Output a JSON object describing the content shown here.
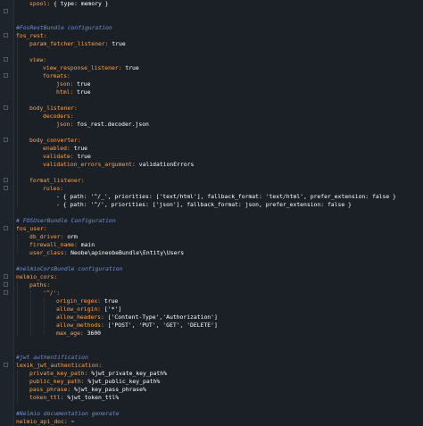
{
  "editor": {
    "lines": [
      {
        "indent": 1,
        "key": "spool:",
        "value": "{ type: memory }"
      },
      {
        "indent": 0,
        "key": "",
        "value": ""
      },
      {
        "indent": 0,
        "key": "",
        "value": ""
      },
      {
        "indent": 0,
        "comment": "#FosRestBundle configuration"
      },
      {
        "indent": 0,
        "key": "fos_rest:",
        "value": ""
      },
      {
        "indent": 1,
        "key": "param_fetcher_listener:",
        "value": "true"
      },
      {
        "indent": 0,
        "key": "",
        "value": ""
      },
      {
        "indent": 1,
        "key": "view:",
        "value": ""
      },
      {
        "indent": 2,
        "key": "view_response_listener:",
        "value": "true"
      },
      {
        "indent": 2,
        "key": "formats:",
        "value": ""
      },
      {
        "indent": 3,
        "key": "json:",
        "value": "true"
      },
      {
        "indent": 3,
        "key": "html:",
        "value": "true"
      },
      {
        "indent": 0,
        "key": "",
        "value": ""
      },
      {
        "indent": 1,
        "key": "body_listener:",
        "value": ""
      },
      {
        "indent": 2,
        "key": "decoders:",
        "value": ""
      },
      {
        "indent": 3,
        "key": "json:",
        "value": "fos_rest.decoder.json"
      },
      {
        "indent": 0,
        "key": "",
        "value": ""
      },
      {
        "indent": 1,
        "key": "body_converter:",
        "value": ""
      },
      {
        "indent": 2,
        "key": "enabled:",
        "value": "true"
      },
      {
        "indent": 2,
        "key": "validate:",
        "value": "true"
      },
      {
        "indent": 2,
        "key": "validation_errors_argument:",
        "value": "validationErrors"
      },
      {
        "indent": 0,
        "key": "",
        "value": ""
      },
      {
        "indent": 1,
        "key": "format_listener:",
        "value": ""
      },
      {
        "indent": 2,
        "key": "rules:",
        "value": ""
      },
      {
        "indent": 3,
        "key": "",
        "value": "- { path: '^/_', priorities: ['text/html'], fallback_format: 'text/html', prefer_extension: false }"
      },
      {
        "indent": 3,
        "key": "",
        "value": "- { path: '^/', priorities: ['json'], fallback_format: json, prefer_extension: false }"
      },
      {
        "indent": 0,
        "key": "",
        "value": ""
      },
      {
        "indent": 0,
        "comment": "# FOSUserBundle Configuration"
      },
      {
        "indent": 0,
        "key": "fos_user:",
        "value": ""
      },
      {
        "indent": 1,
        "key": "db_driver:",
        "value": "orm"
      },
      {
        "indent": 1,
        "key": "firewall_name:",
        "value": "main"
      },
      {
        "indent": 1,
        "key": "user_class:",
        "value": "Neobe\\apineobeBundle\\Entity\\Users"
      },
      {
        "indent": 0,
        "key": "",
        "value": ""
      },
      {
        "indent": 0,
        "comment": "#nelmioCorsBundle configuration"
      },
      {
        "indent": 0,
        "key": "nelmio_cors:",
        "value": ""
      },
      {
        "indent": 1,
        "key": "paths:",
        "value": ""
      },
      {
        "indent": 2,
        "key": "'^/':",
        "value": ""
      },
      {
        "indent": 3,
        "key": "origin_regex:",
        "value": "true"
      },
      {
        "indent": 3,
        "key": "allow_origin:",
        "value": "['*']"
      },
      {
        "indent": 3,
        "key": "allow_headers:",
        "value": "['Content-Type','Authorization']"
      },
      {
        "indent": 3,
        "key": "allow_methods:",
        "value": "['POST', 'PUT', 'GET', 'DELETE']"
      },
      {
        "indent": 3,
        "key": "max_age:",
        "value": "3600"
      },
      {
        "indent": 0,
        "key": "",
        "value": ""
      },
      {
        "indent": 0,
        "key": "",
        "value": ""
      },
      {
        "indent": 0,
        "comment": "#jwt authentification"
      },
      {
        "indent": 0,
        "key": "lexik_jwt_authentication:",
        "value": ""
      },
      {
        "indent": 1,
        "key": "private_key_path:",
        "value": "%jwt_private_key_path%"
      },
      {
        "indent": 1,
        "key": "public_key_path:",
        "value": "%jwt_public_key_path%"
      },
      {
        "indent": 1,
        "key": "pass_phrase:",
        "value": "%jwt_key_pass_phrase%"
      },
      {
        "indent": 1,
        "key": "token_ttl:",
        "value": "%jwt_token_ttl%"
      },
      {
        "indent": 0,
        "key": "",
        "value": ""
      },
      {
        "indent": 0,
        "comment": "#Nelmio documentation generate"
      },
      {
        "indent": 0,
        "key": "nelmio_api_doc:",
        "value": "~"
      }
    ]
  },
  "colors": {
    "background": "#1b2026",
    "key": "#ffa24d",
    "value": "#ffffff",
    "comment": "#6f8fd6"
  }
}
